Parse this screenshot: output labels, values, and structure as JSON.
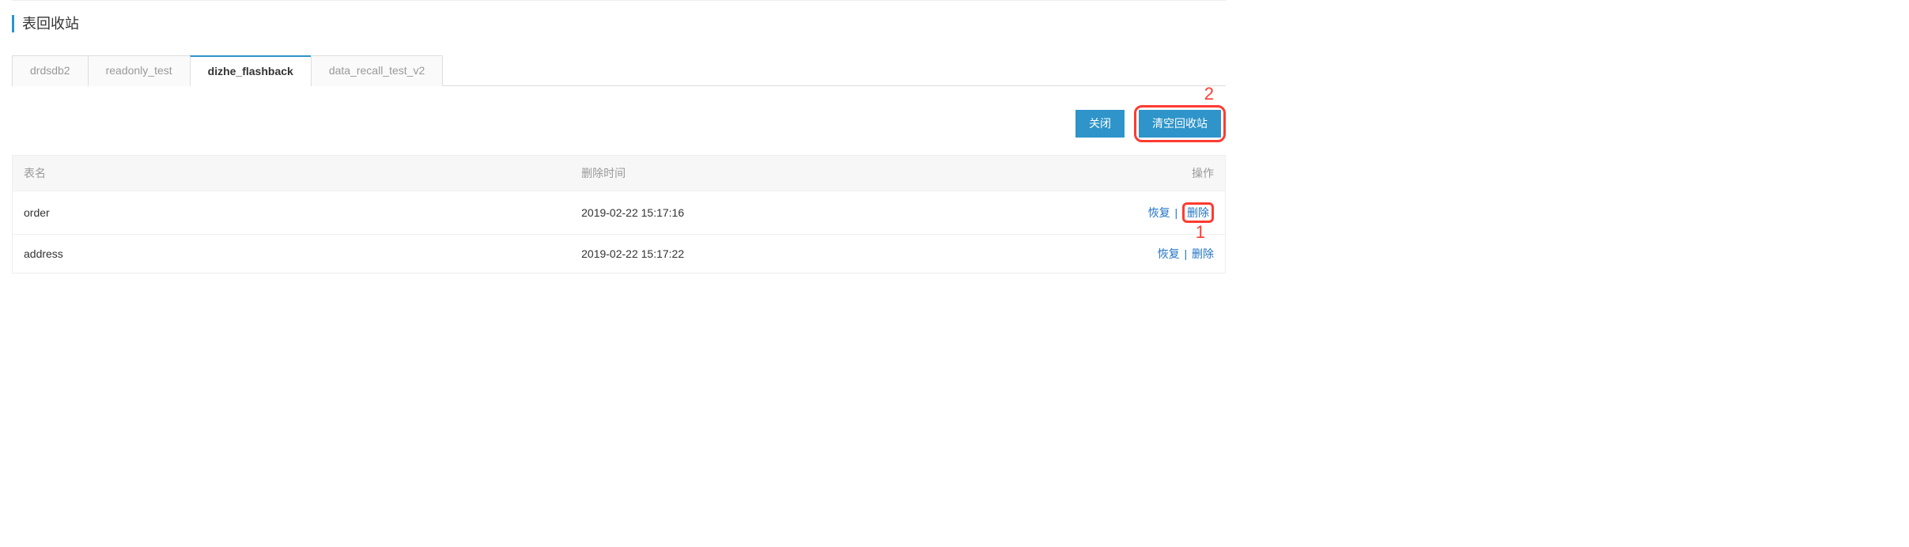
{
  "page": {
    "title": "表回收站"
  },
  "tabs": [
    {
      "label": "drdsdb2",
      "active": false
    },
    {
      "label": "readonly_test",
      "active": false
    },
    {
      "label": "dizhe_flashback",
      "active": true
    },
    {
      "label": "data_recall_test_v2",
      "active": false
    }
  ],
  "actions": {
    "close": "关闭",
    "clearBin": "清空回收站"
  },
  "columns": {
    "name": "表名",
    "deletedAt": "删除时间",
    "ops": "操作"
  },
  "ops": {
    "restore": "恢复",
    "delete": "删除",
    "sep": "|"
  },
  "rows": [
    {
      "name": "order",
      "deletedAt": "2019-02-22 15:17:16"
    },
    {
      "name": "address",
      "deletedAt": "2019-02-22 15:17:22"
    }
  ],
  "annotations": {
    "one": "1",
    "two": "2"
  }
}
